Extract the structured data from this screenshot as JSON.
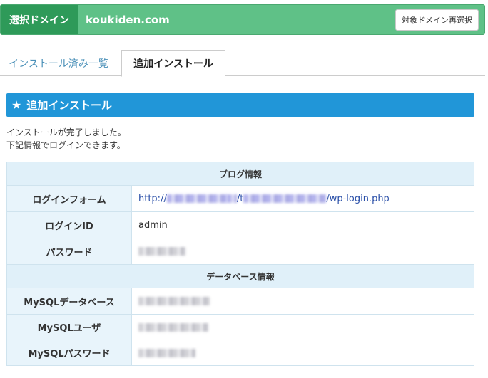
{
  "domain_bar": {
    "label": "選択ドメイン",
    "domain": "koukiden.com",
    "reselect_button": "対象ドメイン再選択"
  },
  "tabs": [
    {
      "label": "インストール済み一覧",
      "active": false
    },
    {
      "label": "追加インストール",
      "active": true
    }
  ],
  "section": {
    "title": "追加インストール",
    "icon": "star-icon"
  },
  "message": {
    "line1": "インストールが完了しました。",
    "line2": "下記情報でログインできます。"
  },
  "blog_info": {
    "heading": "ブログ情報",
    "login_form_label": "ログインフォーム",
    "login_url_prefix": "http://",
    "login_url_mid": "/t",
    "login_url_suffix": "/wp-login.php",
    "login_id_label": "ログインID",
    "login_id_value": "admin",
    "password_label": "パスワード"
  },
  "db_info": {
    "heading": "データベース情報",
    "db_label": "MySQLデータベース",
    "user_label": "MySQLユーザ",
    "password_label": "MySQLパスワード"
  },
  "colors": {
    "domain_bar_bg": "#5fc187",
    "domain_label_bg": "#2e9a59",
    "section_header_bg": "#2196d8",
    "table_head_bg": "#e0f0f9"
  }
}
